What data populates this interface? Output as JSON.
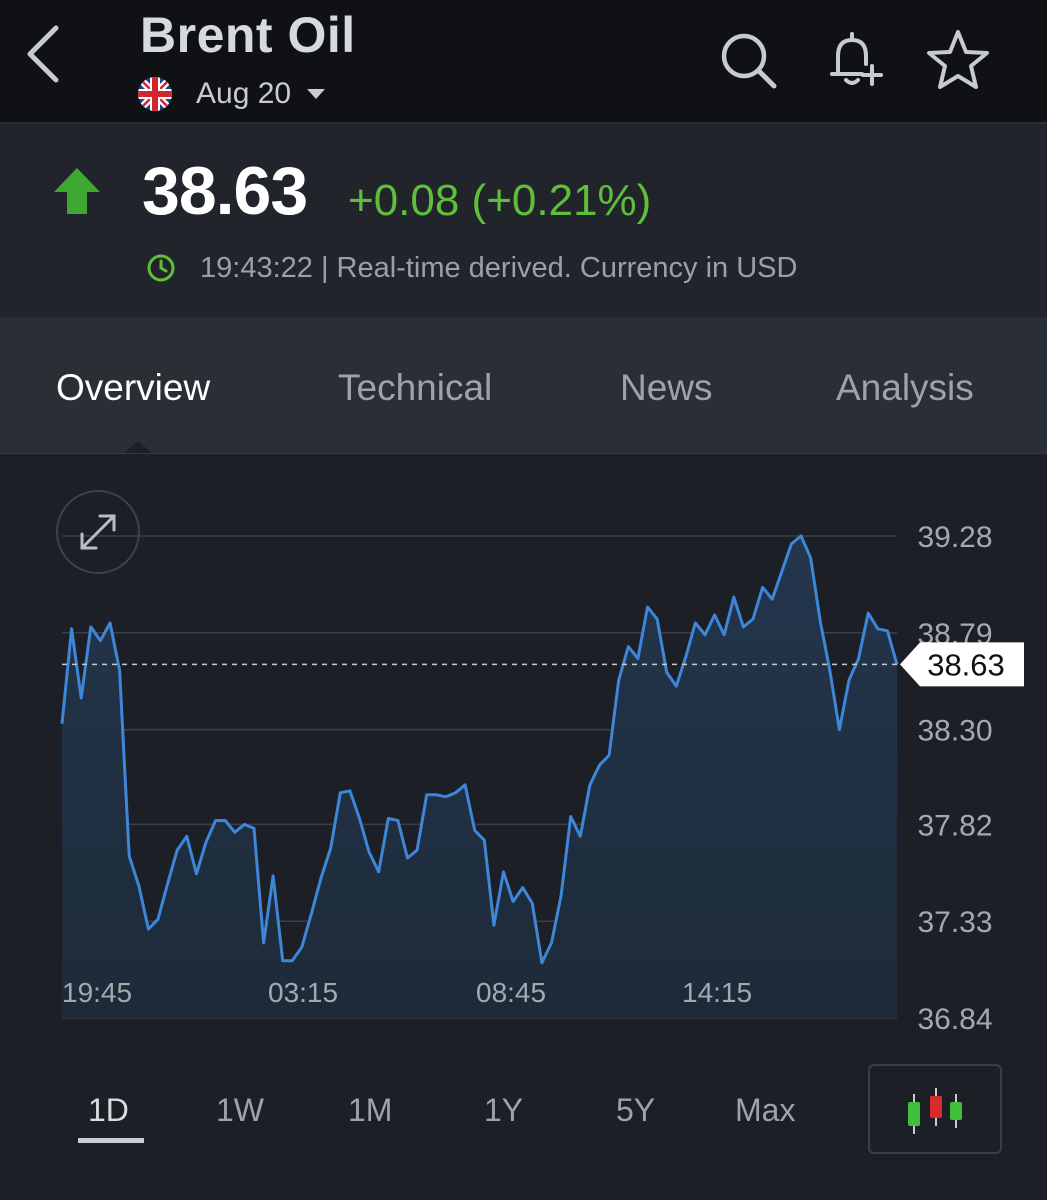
{
  "header": {
    "title": "Brent Oil",
    "contract": "Aug 20",
    "icons": [
      "back-icon",
      "search-icon",
      "bell-plus-icon",
      "star-icon",
      "uk-flag-icon"
    ]
  },
  "quote": {
    "price": "38.63",
    "change": "+0.08 (+0.21%)",
    "time": "19:43:22 | Real-time derived. Currency in USD",
    "direction": "up",
    "up_color": "#5fbf3a"
  },
  "tabs": [
    "Overview",
    "Technical",
    "News",
    "Analysis"
  ],
  "active_tab": "Overview",
  "chart_data": {
    "type": "area",
    "x_tick_labels": [
      "19:45",
      "03:15",
      "08:45",
      "14:15"
    ],
    "y_tick_labels": [
      "39.28",
      "38.79",
      "38.30",
      "37.82",
      "37.33",
      "36.84"
    ],
    "ylim": [
      36.84,
      39.28
    ],
    "current_value": "38.63",
    "grid": true,
    "line_color": "#3d86d8",
    "values": [
      38.33,
      38.81,
      38.46,
      38.82,
      38.75,
      38.84,
      38.6,
      37.66,
      37.51,
      37.29,
      37.34,
      37.52,
      37.69,
      37.76,
      37.57,
      37.73,
      37.84,
      37.84,
      37.78,
      37.82,
      37.8,
      37.22,
      37.56,
      37.13,
      37.13,
      37.2,
      37.37,
      37.55,
      37.7,
      37.98,
      37.99,
      37.85,
      37.68,
      37.58,
      37.85,
      37.84,
      37.65,
      37.69,
      37.97,
      37.97,
      37.96,
      37.98,
      38.02,
      37.79,
      37.74,
      37.31,
      37.58,
      37.43,
      37.5,
      37.42,
      37.12,
      37.22,
      37.46,
      37.86,
      37.76,
      38.02,
      38.12,
      38.17,
      38.55,
      38.72,
      38.66,
      38.92,
      38.86,
      38.59,
      38.52,
      38.67,
      38.84,
      38.78,
      38.88,
      38.78,
      38.97,
      38.82,
      38.86,
      39.02,
      38.96,
      39.1,
      39.24,
      39.28,
      39.17,
      38.85,
      38.6,
      38.3,
      38.55,
      38.66,
      38.89,
      38.81,
      38.8,
      38.63
    ]
  },
  "ranges": [
    "1D",
    "1W",
    "1M",
    "1Y",
    "5Y",
    "Max"
  ],
  "active_range": "1D",
  "candle_colors": [
    "#3fbf3a",
    "#d92b2b",
    "#3fbf3a"
  ]
}
